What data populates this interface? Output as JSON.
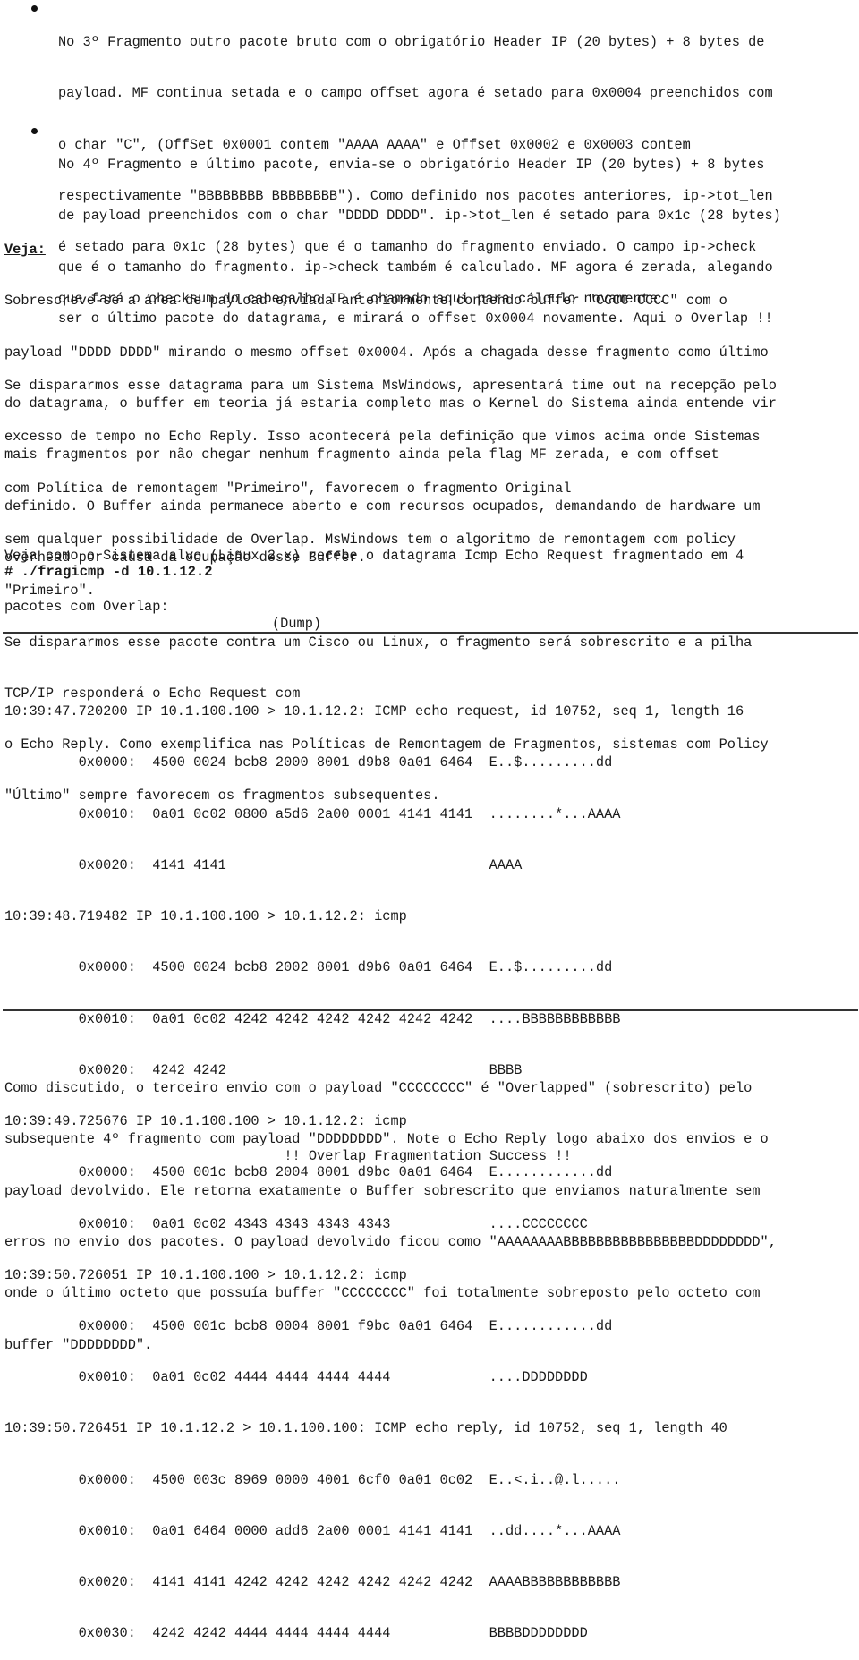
{
  "bullets": [
    {
      "lines": [
        "No 3º Fragmento outro pacote bruto com o obrigatório Header IP (20 bytes) + 8 bytes de",
        "payload. MF continua setada e o campo offset agora é setado para 0x0004 preenchidos com",
        "o char \"C\", (OffSet 0x0001 contem \"AAAA AAAA\" e Offset 0x0002 e 0x0003 contem",
        "respectivamente \"BBBBBBBB BBBBBBBB\"). Como definido nos pacotes anteriores, ip->tot_len",
        "é setado para 0x1c (28 bytes) que é o tamanho do fragmento enviado. O campo ip->check",
        "que fará o checksum do cabeçalho IP é chamado aqui para cálculo novamente."
      ]
    },
    {
      "lines": [
        "No 4º Fragmento e último pacote, envia-se o obrigatório Header IP (20 bytes) + 8 bytes",
        "de payload preenchidos com o char \"DDDD DDDD\". ip->tot_len é setado para 0x1c (28 bytes)",
        "que é o tamanho do fragmento. ip->check também é calculado. MF agora é zerada, alegando",
        "ser o último pacote do datagrama, e mirará o offset 0x0004 novamente. Aqui o Overlap !!"
      ]
    }
  ],
  "veja_label": "Veja:",
  "veja_paragraph": [
    "Sobrescreve-se a área de payload enviada anteriormente contendo buffer \"CCCC CCCC\" com o",
    "payload \"DDDD DDDD\" mirando o mesmo offset 0x0004. Após a chagada desse fragmento como último",
    "do datagrama, o buffer em teoria já estaria completo mas o Kernel do Sistema ainda entende vir",
    "mais fragmentos por não chegar nenhum fragmento ainda pela flag MF zerada, e com offset",
    "definido. O Buffer ainda permanece aberto e com recursos ocupados, demandando de hardware um",
    "overhead por causa da ocupação desse Buffer."
  ],
  "windows_paragraph": [
    "Se dispararmos esse datagrama para um Sistema MsWindows, apresentará time out na recepção pelo",
    "excesso de tempo no Echo Reply. Isso acontecerá pela definição que vimos acima onde Sistemas",
    "com Política de remontagem \"Primeiro\", favorecem o fragmento Original",
    "sem qualquer possibilidade de Overlap. MsWindows tem o algoritmo de remontagem com policy",
    "\"Primeiro\".",
    "Se dispararmos esse pacote contra um Cisco ou Linux, o fragmento será sobrescrito e a pilha",
    "TCP/IP responderá o Echo Request com",
    "o Echo Reply. Como exemplifica nas Políticas de Remontagem de Fragmentos, sistemas com Policy",
    "\"Último\" sempre favorecem os fragmentos subsequentes."
  ],
  "linux_intro": [
    "Veja como o Sistema alvo (Linux 2.x) recebe o datagrama Icmp Echo Request fragmentado em 4",
    "pacotes com Overlap:"
  ],
  "command": "# ./fragicmp -d 10.1.12.2",
  "dump_label": "(Dump)",
  "dump_lines": [
    "10:39:47.720200 IP 10.1.100.100 > 10.1.12.2: ICMP echo request, id 10752, seq 1, length 16",
    "         0x0000:  4500 0024 bcb8 2000 8001 d9b8 0a01 6464  E..$.........dd",
    "         0x0010:  0a01 0c02 0800 a5d6 2a00 0001 4141 4141  ........*...AAAA",
    "         0x0020:  4141 4141                                AAAA",
    "10:39:48.719482 IP 10.1.100.100 > 10.1.12.2: icmp",
    "         0x0000:  4500 0024 bcb8 2002 8001 d9b6 0a01 6464  E..$.........dd",
    "         0x0010:  0a01 0c02 4242 4242 4242 4242 4242 4242  ....BBBBBBBBBBBB",
    "         0x0020:  4242 4242                                BBBB",
    "10:39:49.725676 IP 10.1.100.100 > 10.1.12.2: icmp",
    "         0x0000:  4500 001c bcb8 2004 8001 d9bc 0a01 6464  E............dd",
    "         0x0010:  0a01 0c02 4343 4343 4343 4343            ....CCCCCCCC",
    "10:39:50.726051 IP 10.1.100.100 > 10.1.12.2: icmp",
    "         0x0000:  4500 001c bcb8 0004 8001 f9bc 0a01 6464  E............dd",
    "         0x0010:  0a01 0c02 4444 4444 4444 4444            ....DDDDDDDD",
    "10:39:50.726451 IP 10.1.12.2 > 10.1.100.100: ICMP echo reply, id 10752, seq 1, length 40",
    "         0x0000:  4500 003c 8969 0000 4001 6cf0 0a01 0c02  E..<.i..@.l.....",
    "         0x0010:  0a01 6464 0000 add6 2a00 0001 4141 4141  ..dd....*...AAAA",
    "         0x0020:  4141 4141 4242 4242 4242 4242 4242 4242  AAAABBBBBBBBBBBB",
    "         0x0030:  4242 4242 4444 4444 4444 4444            BBBBDDDDDDDD"
  ],
  "conclusion": [
    "Como discutido, o terceiro envio com o payload \"CCCCCCCC\" é \"Overlapped\" (sobrescrito) pelo",
    "subsequente 4º fragmento com payload \"DDDDDDDD\". Note o Echo Reply logo abaixo dos envios e o",
    "payload devolvido. Ele retorna exatamente o Buffer sobrescrito que enviamos naturalmente sem",
    "erros no envio dos pacotes. O payload devolvido ficou como \"AAAAAAAABBBBBBBBBBBBBBBBDDDDDDDD\",",
    "onde o último octeto que possuía buffer \"CCCCCCCC\" foi totalmente sobreposto pelo octeto com",
    "buffer \"DDDDDDDD\"."
  ],
  "success_banner": "!! Overlap Fragmentation Success !!"
}
